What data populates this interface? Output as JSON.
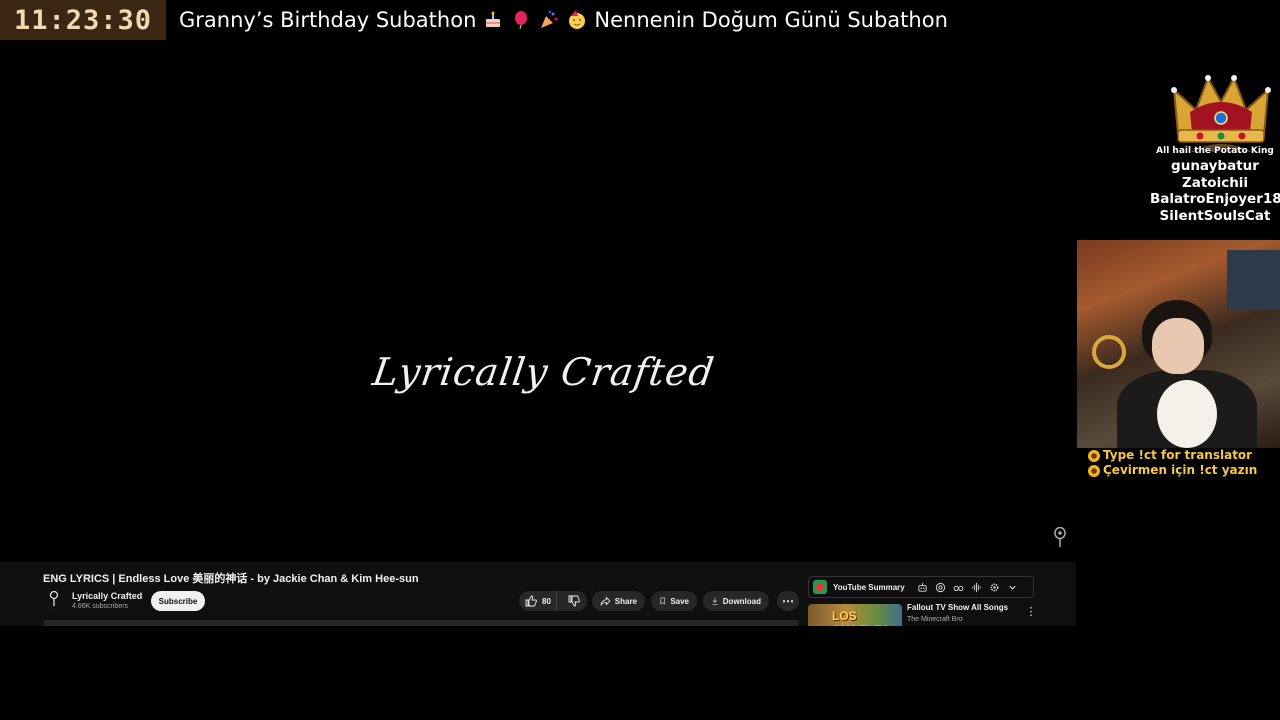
{
  "overlay": {
    "timer": "11:23:30",
    "title_en": "Granny’s Birthday Subathon",
    "title_tr": "Nennenin Doğum Günü Subathon",
    "title_emojis": [
      "cake-icon",
      "balloon-icon",
      "party-popper-icon",
      "partying-face-icon"
    ],
    "crown": {
      "banner": "All hail the Potato King",
      "names": [
        "gunaybatur",
        "Zatoichii",
        "BalatroEnjoyer18",
        "SilentSoulsCat"
      ]
    },
    "translator": {
      "line1": "Type !ct for translator",
      "line2": "Çevirmen için !ct yazın"
    },
    "colors": {
      "timer_bg": "#3a2612",
      "timer_text": "#f2d9b2",
      "translator_text": "#f7c64a"
    }
  },
  "video": {
    "logo_text": "Lyrically Crafted"
  },
  "youtube": {
    "video_title": "ENG LYRICS | Endless Love 美丽的神话 - by Jackie Chan & Kim Hee-sun",
    "channel_name": "Lyrically Crafted",
    "subscribers": "4.66K subscribers",
    "subscribe_label": "Subscribe",
    "like_count": "80",
    "share_label": "Share",
    "save_label": "Save",
    "download_label": "Download",
    "more_label": "⋯",
    "summary_label": "YouTube Summary",
    "summary_tools": [
      "robot-icon",
      "openai-icon",
      "glasses-icon",
      "waveform-icon",
      "settings-icon",
      "chevron-down-icon"
    ],
    "recommended": {
      "thumb_text": "LOS ANGELES",
      "title": "Fallout TV Show All Songs",
      "channel": "The Minecraft Bro",
      "menu_label": "⋮"
    }
  }
}
